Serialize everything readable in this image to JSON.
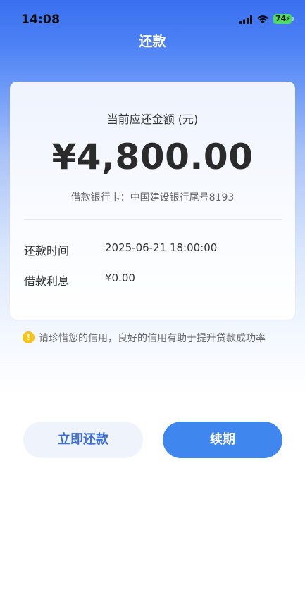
{
  "status_bar": {
    "time": "14:08",
    "battery_level": "74",
    "icons": [
      "signal-icon",
      "wifi-icon",
      "battery-icon"
    ]
  },
  "nav": {
    "title": "还款"
  },
  "repayment": {
    "amount_label": "当前应还金额 (元)",
    "amount": "¥4,800.00",
    "bank_card": "借款银行卡：中国建设银行尾号8193",
    "details": [
      {
        "label": "还款时间",
        "value": "2025-06-21 18:00:00"
      },
      {
        "label": "借款利息",
        "value": "¥0.00"
      }
    ]
  },
  "notice": {
    "icon": "warning-icon",
    "text": "请珍惜您的信用，良好的信用有助于提升贷款成功率"
  },
  "actions": {
    "repay_now": "立即还款",
    "renew": "续期"
  },
  "colors": {
    "header_blue": "#3a6ff0",
    "primary_button": "#3f86ef",
    "secondary_button_bg": "#eef3fc",
    "secondary_button_text": "#3d6fd8",
    "warning": "#f5c518"
  }
}
